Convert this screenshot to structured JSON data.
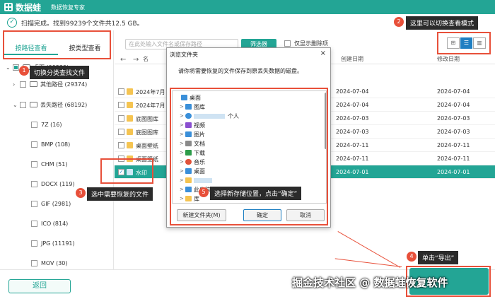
{
  "app": {
    "brand": "数据蛙",
    "subtitle": "数据恢复专家"
  },
  "scan": {
    "status": "扫描完成。找到99239个文件共12.5 GB。"
  },
  "view_tabs": [
    {
      "label": "按路径查看",
      "active": true
    },
    {
      "label": "按类型查看",
      "active": false
    }
  ],
  "search": {
    "placeholder": "在此处输入文件名或保存路径"
  },
  "toolbar": {
    "filter_label": "筛选器",
    "deleted_only_label": "仅显示删除项",
    "view_modes": [
      "grid-icon",
      "list-icon",
      "detail-icon"
    ]
  },
  "tree": [
    {
      "label": "桌面 (99239)",
      "indent": 0
    },
    {
      "label": "其他路径 (29374)",
      "indent": 1
    },
    {
      "label": "丢失路径 (68192)",
      "indent": 1
    },
    {
      "label": "7Z (16)",
      "indent": 2
    },
    {
      "label": "BMP (108)",
      "indent": 2
    },
    {
      "label": "CHM (51)",
      "indent": 2
    },
    {
      "label": "DOCX (119)",
      "indent": 2
    },
    {
      "label": "GIF (2981)",
      "indent": 2
    },
    {
      "label": "ICO (814)",
      "indent": 2
    },
    {
      "label": "JPG (11191)",
      "indent": 2
    },
    {
      "label": "MOV (30)",
      "indent": 2
    }
  ],
  "list": {
    "headers": {
      "name": "名",
      "created": "创建日期",
      "modified": "修改日期"
    },
    "rows": [
      {
        "name": "2024年7月",
        "created": "2024-07-04",
        "modified": "2024-07-04",
        "selected": false
      },
      {
        "name": "2024年7月",
        "created": "2024-07-04",
        "modified": "2024-07-04",
        "selected": false
      },
      {
        "name": "底图图库",
        "created": "2024-07-03",
        "modified": "2024-07-03",
        "selected": false
      },
      {
        "name": "底图图库",
        "created": "2024-07-03",
        "modified": "2024-07-03",
        "selected": false
      },
      {
        "name": "桌面壁纸",
        "created": "2024-07-11",
        "modified": "2024-07-11",
        "selected": false
      },
      {
        "name": "桌面壁纸",
        "created": "2024-07-11",
        "modified": "2024-07-11",
        "selected": false
      },
      {
        "name": "水印",
        "created": "2024-07-01",
        "modified": "2024-07-01",
        "selected": true
      }
    ]
  },
  "dialog": {
    "title": "浏览文件夹",
    "close": "×",
    "description": "请你将需要恢复的文件保存到原丢失数据的磁盘。",
    "tree": [
      {
        "label": "桌面",
        "icon": "desktop-icon",
        "color": "#3a8fd9",
        "chev": "",
        "indent": 0
      },
      {
        "label": "图库",
        "icon": "gallery-icon",
        "color": "#3a8fd9",
        "chev": ">",
        "indent": 1
      },
      {
        "label": "个人",
        "icon": "cloud-icon",
        "color": "#3a8fd9",
        "chev": ">",
        "indent": 1
      },
      {
        "label": "视频",
        "icon": "video-icon",
        "color": "#8a4fd0",
        "chev": ">",
        "indent": 1
      },
      {
        "label": "图片",
        "icon": "pictures-icon",
        "color": "#3a8fd9",
        "chev": ">",
        "indent": 1
      },
      {
        "label": "文档",
        "icon": "documents-icon",
        "color": "#8a8a8a",
        "chev": ">",
        "indent": 1
      },
      {
        "label": "下载",
        "icon": "download-icon",
        "color": "#2d9c4a",
        "chev": ">",
        "indent": 1
      },
      {
        "label": "音乐",
        "icon": "music-icon",
        "color": "#e0523a",
        "chev": ">",
        "indent": 1
      },
      {
        "label": "桌面",
        "icon": "desktop-icon",
        "color": "#3a8fd9",
        "chev": ">",
        "indent": 1
      },
      {
        "label": "",
        "icon": "folder-icon",
        "color": "#f5c451",
        "chev": ">",
        "indent": 1
      },
      {
        "label": "此电脑",
        "icon": "computer-icon",
        "color": "#3a8fd9",
        "chev": ">",
        "indent": 1
      },
      {
        "label": "库",
        "icon": "library-icon",
        "color": "#f5c451",
        "chev": ">",
        "indent": 1
      }
    ],
    "new_folder_label": "新建文件夹(M)",
    "ok_label": "确定",
    "cancel_label": "取消"
  },
  "annotations": [
    {
      "num": "1",
      "text": "切换分类查找文件"
    },
    {
      "num": "2",
      "text": "这里可以切换查看模式"
    },
    {
      "num": "3",
      "text": "选中需要恢复的文件"
    },
    {
      "num": "4",
      "text": "单击“导出”"
    },
    {
      "num": "5",
      "text": "选择新存储位置，点击“确定”"
    }
  ],
  "footer": {
    "back_label": "返回",
    "watermark": "掘金技术社区 @ 数据蛙恢复软件"
  },
  "colors": {
    "accent": "#23a595",
    "annotation": "#e8503a",
    "select": "#1f7fc2"
  }
}
